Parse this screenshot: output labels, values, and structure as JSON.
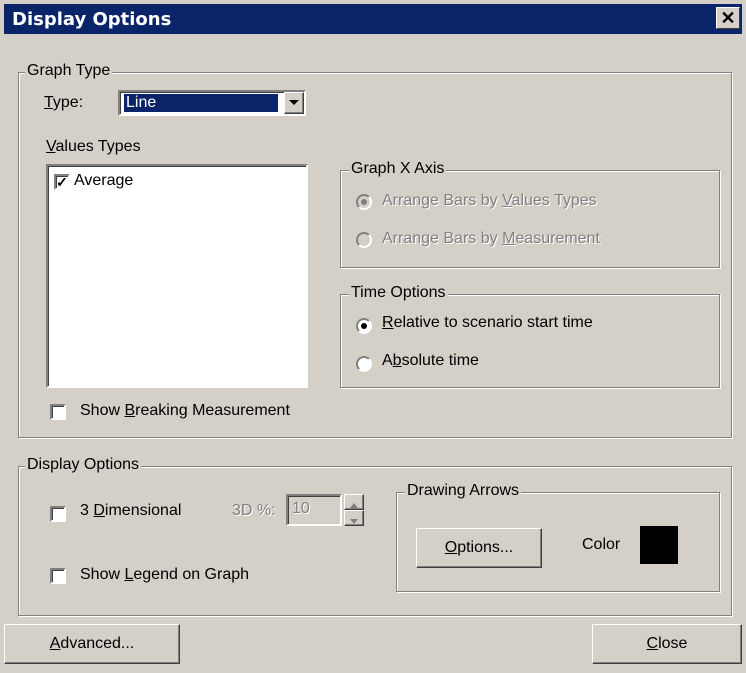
{
  "window": {
    "title": "Display Options",
    "close_glyph": "✕"
  },
  "graph_type": {
    "legend": "Graph Type",
    "type_label": "Type:",
    "type_value": "Line",
    "values_types_label": "Values Types",
    "values": [
      {
        "label": "Average",
        "checked": true
      }
    ],
    "show_breaking": {
      "label": "Show Breaking Measurement",
      "checked": false
    }
  },
  "graph_x_axis": {
    "legend": "Graph X Axis",
    "options": [
      {
        "label": "Arrange Bars by Values Types",
        "selected": true,
        "enabled": false
      },
      {
        "label": "Arrange Bars by Measurement",
        "selected": false,
        "enabled": false
      }
    ]
  },
  "time_options": {
    "legend": "Time Options",
    "options": [
      {
        "label": "Relative to scenario start time",
        "selected": true
      },
      {
        "label": "Absolute time",
        "selected": false
      }
    ]
  },
  "display_options": {
    "legend": "Display Options",
    "three_d": {
      "label": "3 Dimensional",
      "checked": false
    },
    "three_d_percent_label": "3D %:",
    "three_d_percent_value": "10",
    "show_legend": {
      "label": "Show Legend on Graph",
      "checked": false
    }
  },
  "drawing_arrows": {
    "legend": "Drawing Arrows",
    "options_button": "Options...",
    "color_label": "Color",
    "color_value": "#000000"
  },
  "footer": {
    "advanced_button": "Advanced...",
    "close_button": "Close"
  }
}
